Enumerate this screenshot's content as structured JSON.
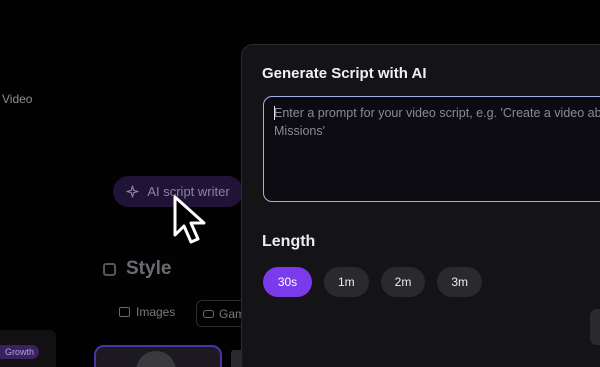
{
  "background": {
    "video_label": "Video",
    "ai_button_label": "AI script writer",
    "style_title": "Style",
    "images_label": "Images",
    "games_label": "Gam",
    "growth_badge": "Growth"
  },
  "modal": {
    "title": "Generate Script with AI",
    "prompt_placeholder": "Enter a prompt for your video script, e.g. 'Create a video about Missions'",
    "prompt_value": "",
    "length_label": "Length",
    "length_options": [
      "30s",
      "1m",
      "2m",
      "3m"
    ],
    "selected_length": "30s"
  },
  "colors": {
    "accent": "#7c3aed",
    "focus_border": "#9cb2e6",
    "panel": "#141416"
  },
  "icons": [
    "sparkle-icon",
    "style-icon",
    "image-icon",
    "gamepad-icon",
    "cursor-icon"
  ]
}
